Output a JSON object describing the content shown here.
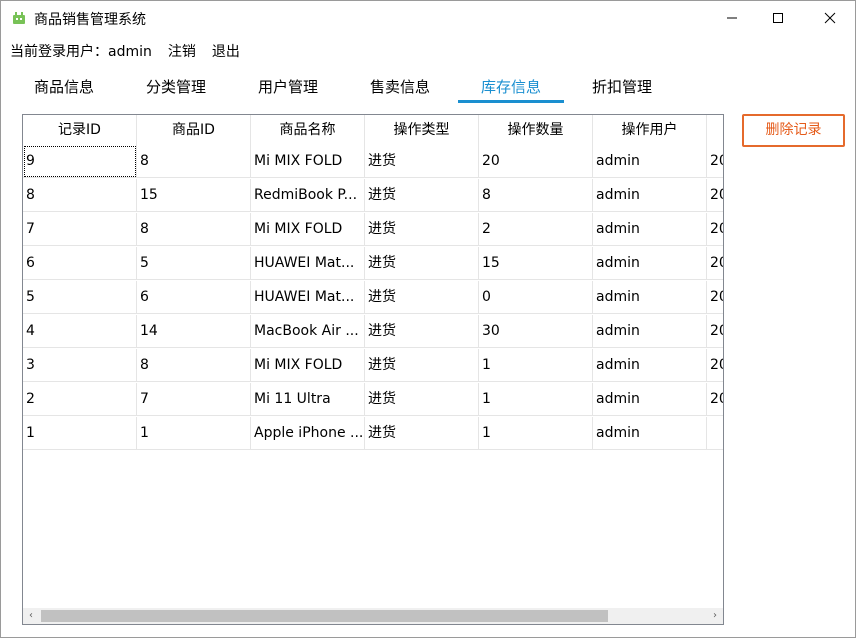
{
  "window": {
    "title": "商品销售管理系统",
    "minimize": "—",
    "maximize": "☐",
    "close": "✕"
  },
  "login": {
    "label": "当前登录用户：admin",
    "logout": "注销",
    "exit": "退出"
  },
  "tabs": [
    "商品信息",
    "分类管理",
    "用户管理",
    "售卖信息",
    "库存信息",
    "折扣管理"
  ],
  "active_tab": "库存信息",
  "table": {
    "columns": [
      "记录ID",
      "商品ID",
      "商品名称",
      "操作类型",
      "操作数量",
      "操作用户",
      ""
    ],
    "rows": [
      [
        "9",
        "8",
        "Mi MIX FOLD",
        "进货",
        "20",
        "admin",
        "20"
      ],
      [
        "8",
        "15",
        "RedmiBook P...",
        "进货",
        "8",
        "admin",
        "20"
      ],
      [
        "7",
        "8",
        "Mi MIX FOLD",
        "进货",
        "2",
        "admin",
        "20"
      ],
      [
        "6",
        "5",
        "HUAWEI Mat...",
        "进货",
        "15",
        "admin",
        "20"
      ],
      [
        "5",
        "6",
        "HUAWEI Mat...",
        "进货",
        "0",
        "admin",
        "20"
      ],
      [
        "4",
        "14",
        "MacBook Air ...",
        "进货",
        "30",
        "admin",
        "20"
      ],
      [
        "3",
        "8",
        "Mi MIX FOLD",
        "进货",
        "1",
        "admin",
        "20"
      ],
      [
        "2",
        "7",
        "Mi 11 Ultra",
        "进货",
        "1",
        "admin",
        "20"
      ],
      [
        "1",
        "1",
        "Apple iPhone ...",
        "进货",
        "1",
        "admin",
        ""
      ]
    ]
  },
  "scrollbar": {
    "left_arrow": "‹",
    "right_arrow": "›"
  },
  "delete_button": "删除记录",
  "colors": {
    "accent": "#1a8fd0",
    "danger": "#e55b1a",
    "icon": "#78c257"
  }
}
